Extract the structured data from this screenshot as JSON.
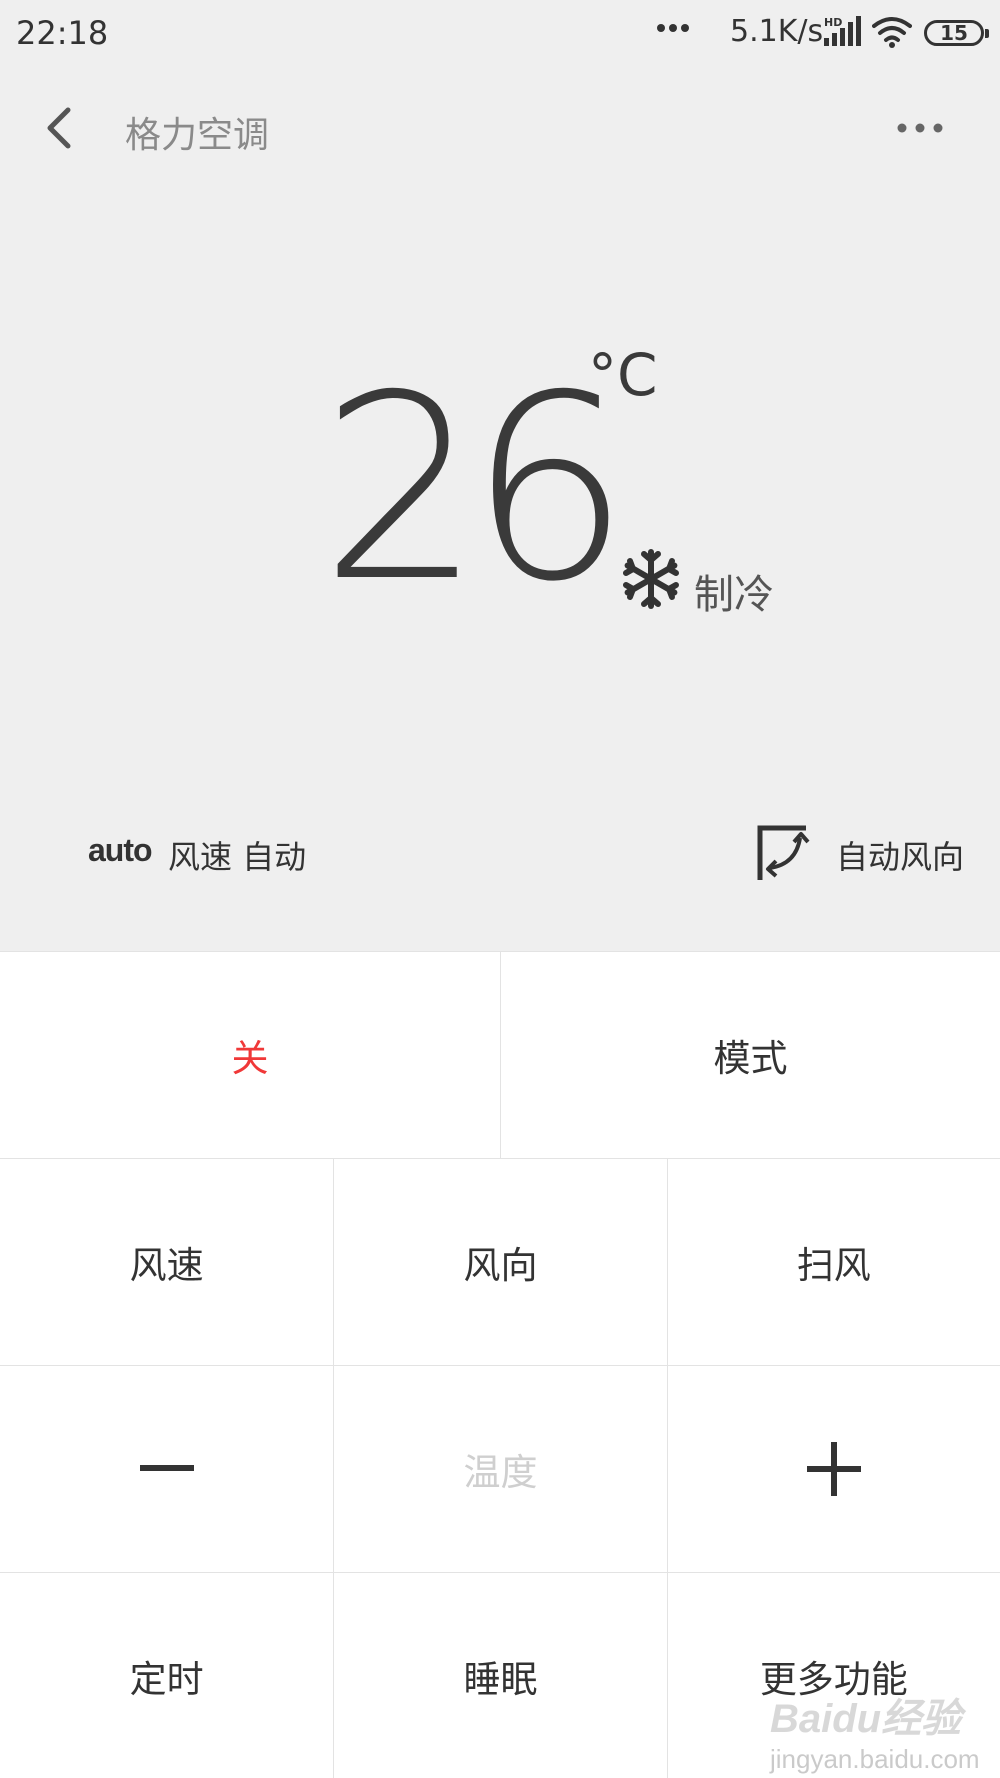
{
  "status_bar": {
    "time": "22:18",
    "speed": "5.1K/s",
    "battery": "15"
  },
  "header": {
    "title": "格力空调"
  },
  "display": {
    "temperature": "26",
    "unit": "°C",
    "mode": "制冷",
    "fan_icon_label": "auto",
    "fan_speed": "风速 自动",
    "swing": "自动风向"
  },
  "controls": {
    "power": "关",
    "mode": "模式",
    "fan_speed": "风速",
    "direction": "风向",
    "sweep": "扫风",
    "temperature": "温度",
    "timer": "定时",
    "sleep": "睡眠",
    "more": "更多功能"
  },
  "watermark": {
    "brand": "Baidu经验",
    "url": "jingyan.baidu.com"
  },
  "colors": {
    "power_red": "#f03838",
    "background_top": "#efefef"
  }
}
